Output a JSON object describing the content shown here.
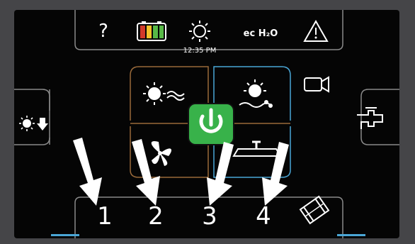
{
  "status_bar": {
    "help_label": "?",
    "time": "12:35 PM",
    "eco_label": "ec H₂O",
    "battery_colors": [
      "#d23a2a",
      "#f4c22b",
      "#58b947",
      "#58b947"
    ]
  },
  "left_control": {
    "icon": "sun-down-icon"
  },
  "right_controls": {
    "camera_icon": "video-camera-icon",
    "faucet_icon": "faucet-icon"
  },
  "center": {
    "power_icon": "power-icon",
    "power_color": "#38b24a",
    "modes": [
      {
        "name": "sun-wind-icon"
      },
      {
        "name": "sun-water-icon"
      },
      {
        "name": "fan-icon"
      },
      {
        "name": "sprinkler-icon"
      }
    ]
  },
  "bottom": {
    "labels": [
      "1",
      "2",
      "3",
      "4"
    ],
    "film_icon": "film-icon"
  }
}
